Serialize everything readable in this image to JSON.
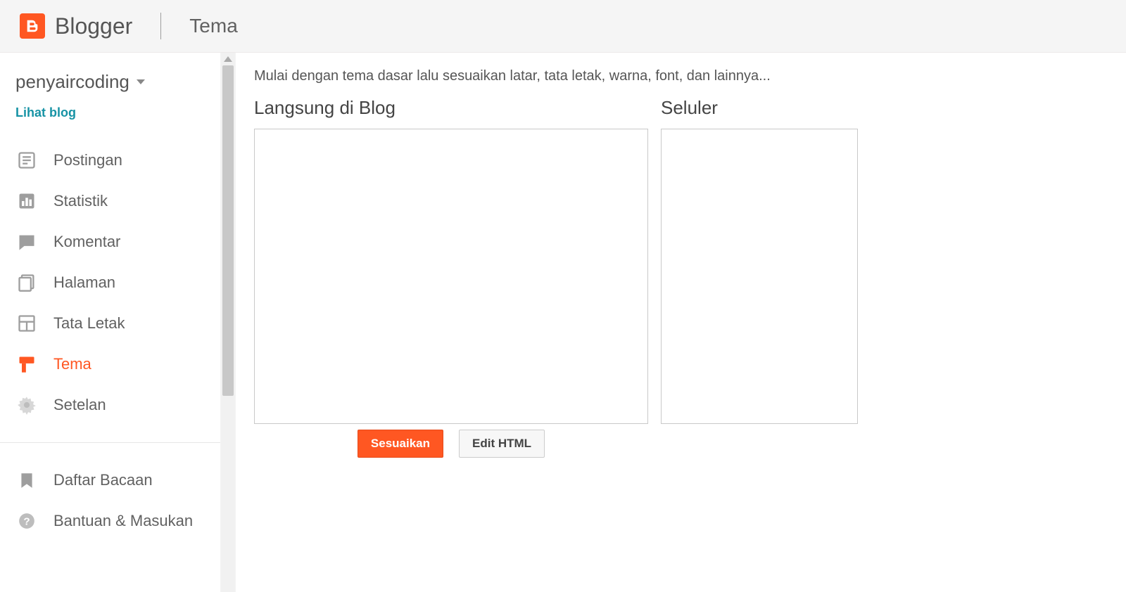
{
  "header": {
    "brand": "Blogger",
    "page_title": "Tema"
  },
  "sidebar": {
    "blog_name": "penyaircoding",
    "view_blog": "Lihat blog",
    "nav": [
      {
        "label": "Postingan",
        "icon": "posts"
      },
      {
        "label": "Statistik",
        "icon": "stats"
      },
      {
        "label": "Komentar",
        "icon": "comments"
      },
      {
        "label": "Halaman",
        "icon": "pages"
      },
      {
        "label": "Tata Letak",
        "icon": "layout"
      },
      {
        "label": "Tema",
        "icon": "theme"
      },
      {
        "label": "Setelan",
        "icon": "settings"
      }
    ],
    "secondary": [
      {
        "label": "Daftar Bacaan",
        "icon": "reading"
      },
      {
        "label": "Bantuan & Masukan",
        "icon": "help"
      }
    ]
  },
  "main": {
    "intro": "Mulai dengan tema dasar lalu sesuaikan latar, tata letak, warna, font, dan lainnya...",
    "blog_preview_title": "Langsung di Blog",
    "mobile_preview_title": "Seluler",
    "buttons": {
      "customize": "Sesuaikan",
      "edit_html": "Edit HTML"
    }
  },
  "colors": {
    "accent": "#ff5722",
    "link": "#1793a5"
  }
}
